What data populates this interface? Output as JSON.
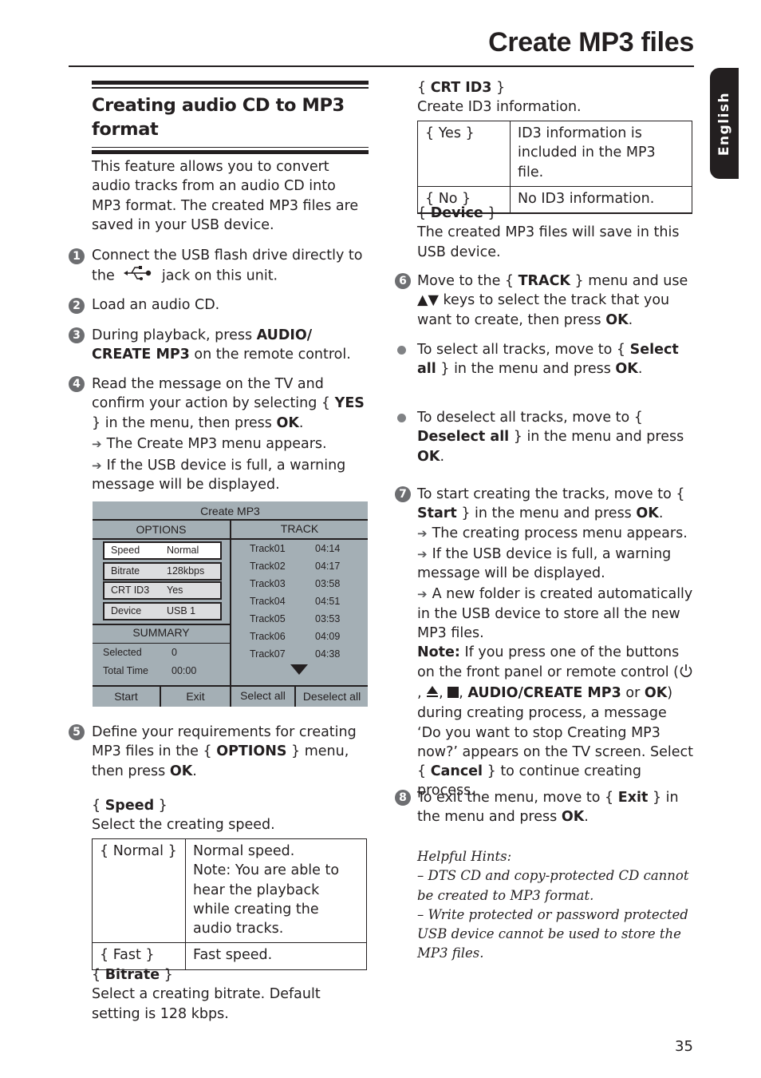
{
  "header": {
    "title": "Create MP3 files",
    "language_tab": "English"
  },
  "section": {
    "title_line1": "Creating audio CD to MP3",
    "title_line2": "format"
  },
  "intro": "This feature allows you to convert audio tracks from an audio CD into MP3 format. The created MP3 files are saved in your USB device.",
  "steps": {
    "s1": {
      "num": "1",
      "text_a": "Connect the USB flash drive directly to the",
      "icon": "usb-icon",
      "text_b": "jack on this unit."
    },
    "s2": {
      "num": "2",
      "text": "Load an audio CD."
    },
    "s3": {
      "num": "3",
      "text_a": "During playback, press ",
      "bold": "AUDIO/ CREATE MP3",
      "text_b": " on the remote control."
    },
    "s4": {
      "num": "4",
      "text_a": "Read the message on the TV and confirm your action by selecting { ",
      "bold_a": "YES",
      "text_b": " } in the menu, then press ",
      "bold_b": "OK",
      "text_c": ".",
      "result1": "The Create MP3 menu appears.",
      "result2": "If the USB device is full, a warning message will be displayed."
    },
    "s5": {
      "num": "5",
      "text_a": "Define your requirements for creating MP3 files in the { ",
      "bold_a": "OPTIONS",
      "text_b": " } menu, then press ",
      "bold_b": "OK",
      "text_c": "."
    },
    "s6": {
      "num": "6",
      "text_a": "Move to the { ",
      "bold_a": "TRACK",
      "text_b": " } menu and use ",
      "keys": "▲▼",
      "text_c": " keys to select the track that you want to create, then press ",
      "bold_b": "OK",
      "text_d": "."
    },
    "s7": {
      "num": "7",
      "text_a": "To start creating the tracks, move to { ",
      "bold_a": "Start",
      "text_b": " } in the menu and press ",
      "bold_b": "OK",
      "text_c": ".",
      "result1": "The creating process menu appears.",
      "result2": "If the USB device is full, a warning message will be displayed.",
      "result3": "A new folder is created automatically in the USB device to store all the new MP3 files.",
      "note_label": "Note:",
      "note_a": " If you press one of the buttons on the front panel or remote control (",
      "note_b": ", ",
      "note_c": ", ",
      "note_bold": "AUDIO/CREATE MP3",
      "note_d": " or ",
      "note_ok": "OK",
      "note_e": ") during creating process, a message ‘Do you want to stop Creating MP3 now?’ appears on the TV screen. Select { ",
      "note_cancel": "Cancel",
      "note_f": " } to continue creating process."
    },
    "s8": {
      "num": "8",
      "text_a": "To exit the menu, move to { ",
      "bold_a": "Exit",
      "text_b": " } in the menu and press ",
      "bold_b": "OK",
      "text_c": "."
    }
  },
  "bullets": {
    "select_all": {
      "text_a": "To select all tracks, move to { ",
      "bold": "Select all",
      "text_b": " } in the menu and press ",
      "ok": "OK",
      "text_c": "."
    },
    "deselect_all": {
      "text_a": "To deselect all tracks, move to { ",
      "bold": "Deselect all",
      "text_b": " } in the menu and press ",
      "ok": "OK",
      "text_c": "."
    }
  },
  "menu": {
    "title": "Create MP3",
    "options_header": "OPTIONS",
    "track_header": "TRACK",
    "options": [
      {
        "key": "Speed",
        "value": "Normal"
      },
      {
        "key": "Bitrate",
        "value": "128kbps"
      },
      {
        "key": "CRT ID3",
        "value": "Yes"
      },
      {
        "key": "Device",
        "value": "USB 1"
      }
    ],
    "summary_header": "SUMMARY",
    "summary": [
      {
        "key": "Selected",
        "value": "0"
      },
      {
        "key": "Total Time",
        "value": "00:00"
      }
    ],
    "tracks": [
      {
        "name": "Track01",
        "duration": "04:14"
      },
      {
        "name": "Track02",
        "duration": "04:17"
      },
      {
        "name": "Track03",
        "duration": "03:58"
      },
      {
        "name": "Track04",
        "duration": "04:51"
      },
      {
        "name": "Track05",
        "duration": "03:53"
      },
      {
        "name": "Track06",
        "duration": "04:09"
      },
      {
        "name": "Track07",
        "duration": "04:38"
      }
    ],
    "buttons": {
      "start": "Start",
      "exit": "Exit",
      "select_all": "Select all",
      "deselect_all": "Deselect all"
    }
  },
  "speed": {
    "heading_bold": "Speed",
    "desc": "Select the creating speed.",
    "rows": [
      {
        "option": "{ Normal }",
        "desc1": "Normal speed.",
        "desc2": "Note:  You are able to hear the playback while creating the audio tracks."
      },
      {
        "option": "{ Fast }",
        "desc1": "Fast speed."
      }
    ]
  },
  "bitrate": {
    "heading_bold": "Bitrate",
    "desc": "Select a creating bitrate.  Default setting is 128 kbps."
  },
  "crt_id3": {
    "heading_bold": "CRT ID3",
    "desc": "Create ID3 information.",
    "rows": [
      {
        "option": "{ Yes }",
        "desc": "ID3 information is included in the MP3 file."
      },
      {
        "option": "{ No }",
        "desc": "No ID3 information."
      }
    ]
  },
  "device": {
    "heading_bold": "Device",
    "desc": "The created MP3 files will save in this USB device."
  },
  "hints": {
    "title": "Helpful Hints:",
    "items": [
      "–  DTS CD and copy-protected CD cannot be created to MP3 format.",
      "–  Write protected or password protected USB device cannot be used to store the MP3 files."
    ]
  },
  "footer": {
    "page_number": "35"
  }
}
